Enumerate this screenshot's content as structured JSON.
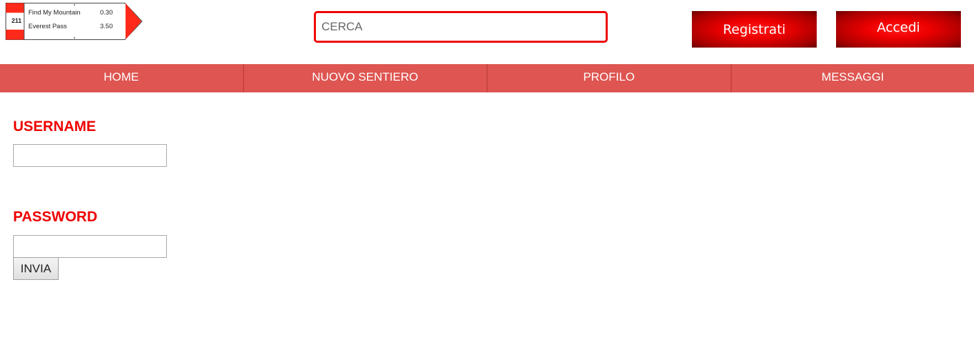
{
  "logo": {
    "number": "211",
    "rows": [
      {
        "name": "Find My Mountain",
        "distance": "0.30"
      },
      {
        "name": "Everest Pass",
        "distance": "3.50"
      }
    ],
    "colors": {
      "red": "#ff2a1a",
      "border": "#444444"
    }
  },
  "search": {
    "placeholder": "CERCA"
  },
  "header_buttons": {
    "register_label": "Registrati",
    "login_label": "Accedi"
  },
  "nav": {
    "items": [
      {
        "label": "HOME"
      },
      {
        "label": "NUOVO SENTIERO"
      },
      {
        "label": "PROFILO"
      },
      {
        "label": "MESSAGGI"
      }
    ]
  },
  "login_form": {
    "username_label": "USERNAME",
    "username_value": "",
    "password_label": "PASSWORD",
    "password_value": "",
    "submit_label": "INVIA"
  },
  "colors": {
    "accent": "#ee0000",
    "nav_background": "#de5551",
    "button_gradient_center": "#ff1a1a",
    "button_gradient_edge": "#6a0000"
  }
}
